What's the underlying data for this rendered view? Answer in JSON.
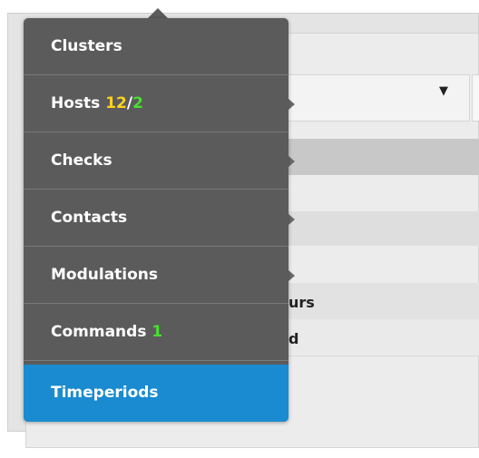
{
  "menu": {
    "items": [
      {
        "label": "Clusters"
      },
      {
        "label": "Hosts",
        "count_warning": "12",
        "separator": "/",
        "count_ok": "2"
      },
      {
        "label": "Checks"
      },
      {
        "label": "Contacts"
      },
      {
        "label": "Modulations"
      },
      {
        "label": "Commands",
        "count_ok": "1"
      },
      {
        "label": "Timeperiods",
        "active": true
      }
    ]
  },
  "background": {
    "select_arrow": "▼",
    "row_text_1": "urs",
    "row_text_2": "d"
  },
  "colors": {
    "menu_bg": "#5b5b5b",
    "active_bg": "#1a8bd0",
    "warning_count": "#ffd21f",
    "ok_count": "#47e02e"
  }
}
